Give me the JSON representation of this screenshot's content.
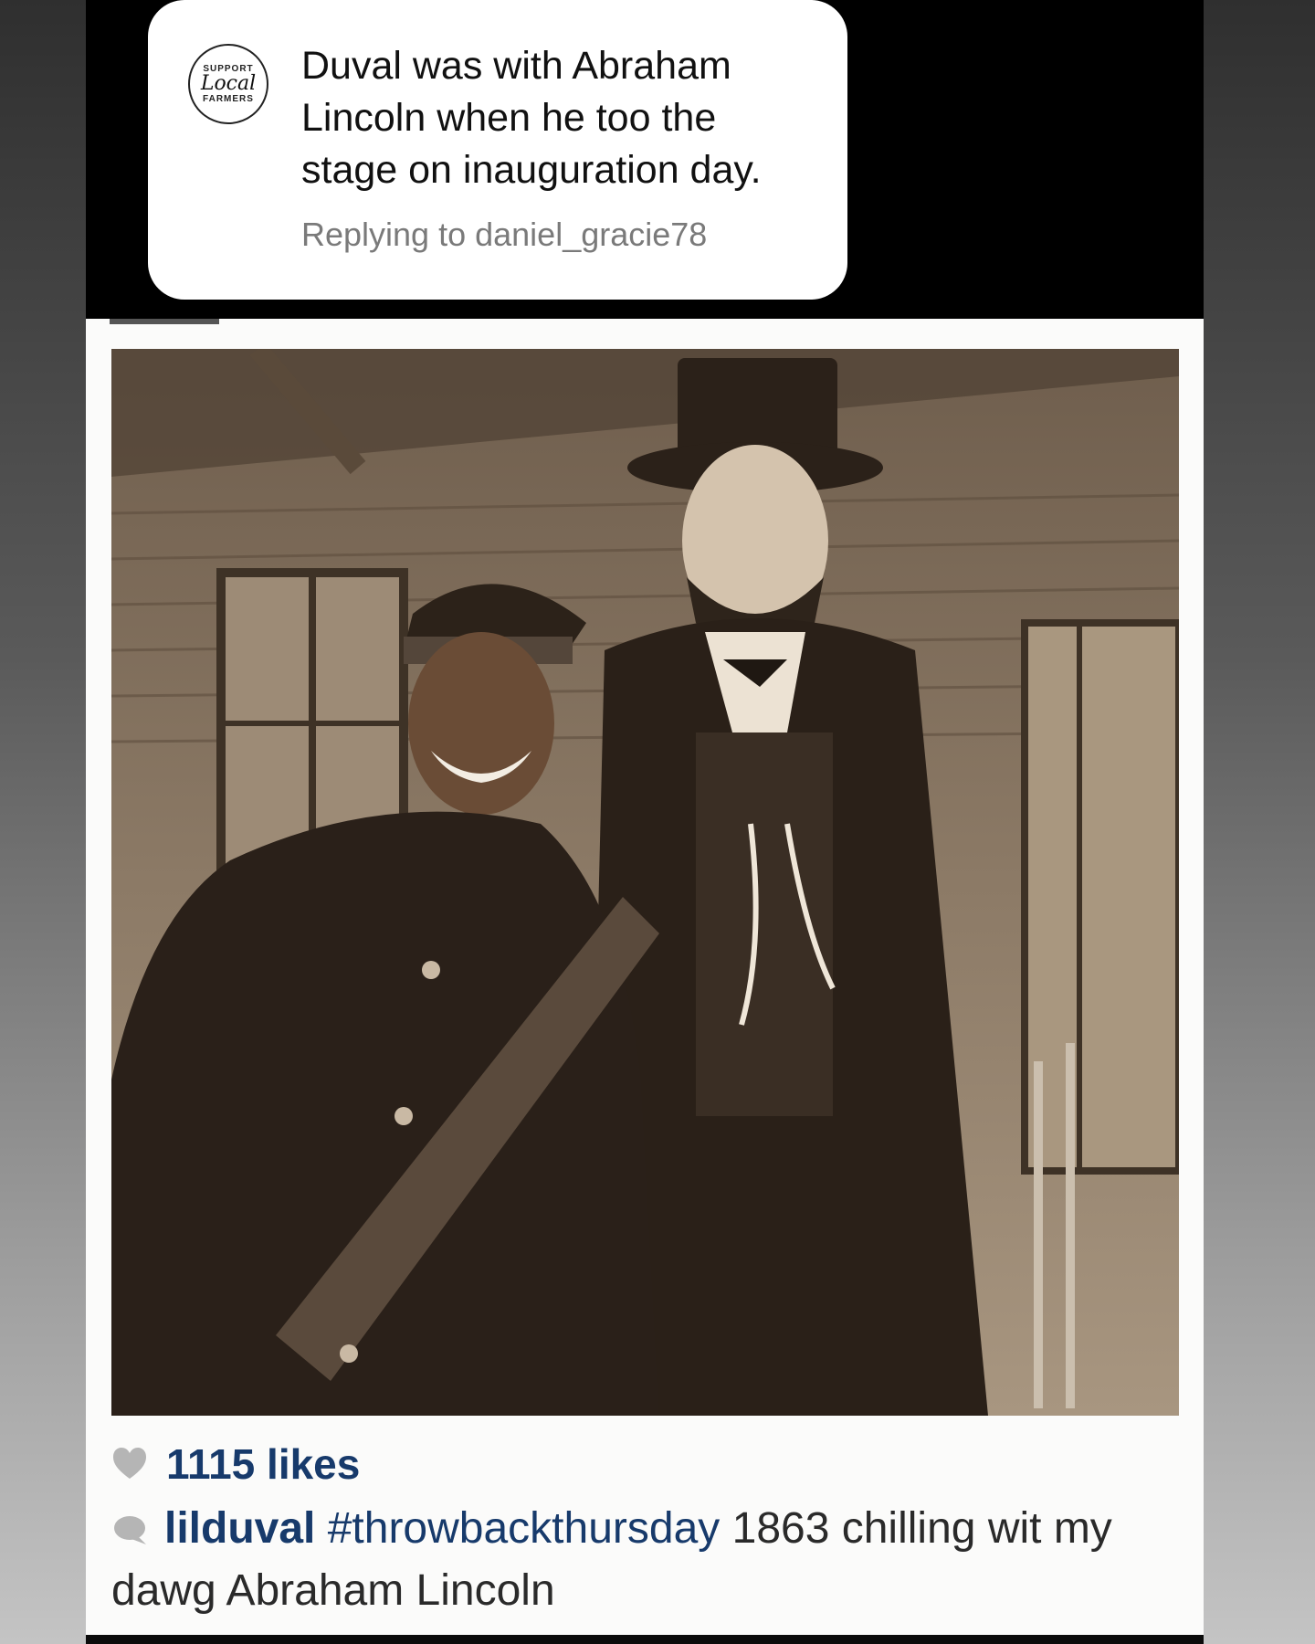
{
  "reply_sticker": {
    "badge_top": "SUPPORT",
    "badge_middle": "Local",
    "badge_bottom": "FARMERS",
    "text": "Duval was with Abraham Lincoln when he too the stage on inauguration day.",
    "subtext": "Replying to daniel_gracie78"
  },
  "post": {
    "likes": "1115 likes",
    "username": "lilduval",
    "hashtag": "#throwbackthursday",
    "caption": " 1863 chilling wit my dawg Abraham Lincoln",
    "icons": {
      "like": "heart-icon",
      "comment": "comment-icon"
    }
  },
  "colors": {
    "link": "#173a6b",
    "sepia_dark": "#3a2a1e",
    "sepia_light": "#b4a28c"
  }
}
